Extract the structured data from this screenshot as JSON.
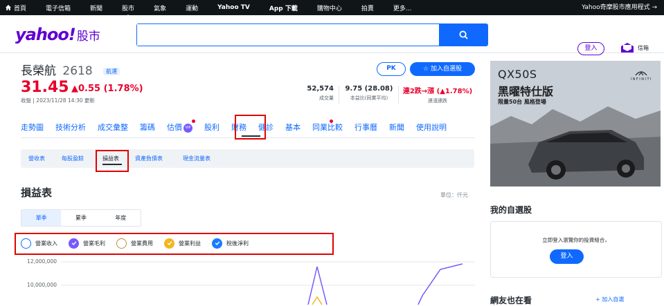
{
  "topbar": {
    "items": [
      "首頁",
      "電子信箱",
      "新聞",
      "股市",
      "氣象",
      "運動",
      "Yahoo TV",
      "App 下載",
      "購物中心",
      "拍賣",
      "更多..."
    ],
    "right_link": "Yahoo奇摩股市應用程式 →"
  },
  "header": {
    "logo": "yahoo!",
    "logo_sub": "股市",
    "search_placeholder": "",
    "login": "登入",
    "mail": "信箱"
  },
  "quote": {
    "name": "長榮航",
    "code": "2618",
    "tag": "航運",
    "price": "31.45",
    "change": "▲0.55 (1.78%)",
    "time": "收盤 | 2023/11/28 14:30 更新",
    "pk": "PK",
    "add_watch": "☆ 加入自選股",
    "volume_value": "52,574",
    "volume_label": "成交量",
    "pe_value": "9.75 (28.08)",
    "pe_label": "本益比(同業平均)",
    "streak_value": "連2跌→漲 (▲1.78%)",
    "streak_label": "連漲連跌",
    "colors": {
      "up": "#e8002a",
      "accent": "#0f69ff"
    }
  },
  "tabs": [
    "走勢圖",
    "技術分析",
    "成交彙整",
    "籌碼",
    "估價",
    "股利",
    "財務",
    "健診",
    "基本",
    "同業比較",
    "行事曆",
    "新聞",
    "使用說明"
  ],
  "tab_vip": "VIP",
  "active_tab": "財務",
  "subtabs": [
    "營收表",
    "每股盈餘",
    "損益表",
    "資產負債表",
    "現金流量表"
  ],
  "active_subtab": "損益表",
  "section": {
    "title": "損益表",
    "unit": "單位：仟元",
    "periods": [
      "單季",
      "累季",
      "年度"
    ],
    "active_period": "單季"
  },
  "legend": [
    {
      "name": "營業收入",
      "checked": false,
      "color": "#0f69ff"
    },
    {
      "name": "營業毛利",
      "checked": true,
      "color": "#7759ff"
    },
    {
      "name": "營業費用",
      "checked": false,
      "color": "#c08a3a"
    },
    {
      "name": "營業利益",
      "checked": true,
      "color": "#f5b51e"
    },
    {
      "name": "稅後淨利",
      "checked": true,
      "color": "#1b7bff"
    }
  ],
  "chart_data": {
    "type": "line",
    "yticks": [
      "12,000,000",
      "10,000,000"
    ],
    "series": [
      {
        "name": "營業毛利",
        "color": "#7759ff"
      },
      {
        "name": "營業利益",
        "color": "#f5b51e"
      }
    ]
  },
  "sidebar": {
    "ad_title": "QX50S",
    "ad_sub": "黑曜特仕版",
    "ad_line": "限量50台 風格登場",
    "ad_brand": "INFINITI",
    "watch_title": "我的自選股",
    "watch_msg": "立即登入瀏覽你的投資組合，",
    "watch_btn": "登入",
    "friends_title": "網友也在看",
    "friends_add": "+ 加入自選"
  }
}
